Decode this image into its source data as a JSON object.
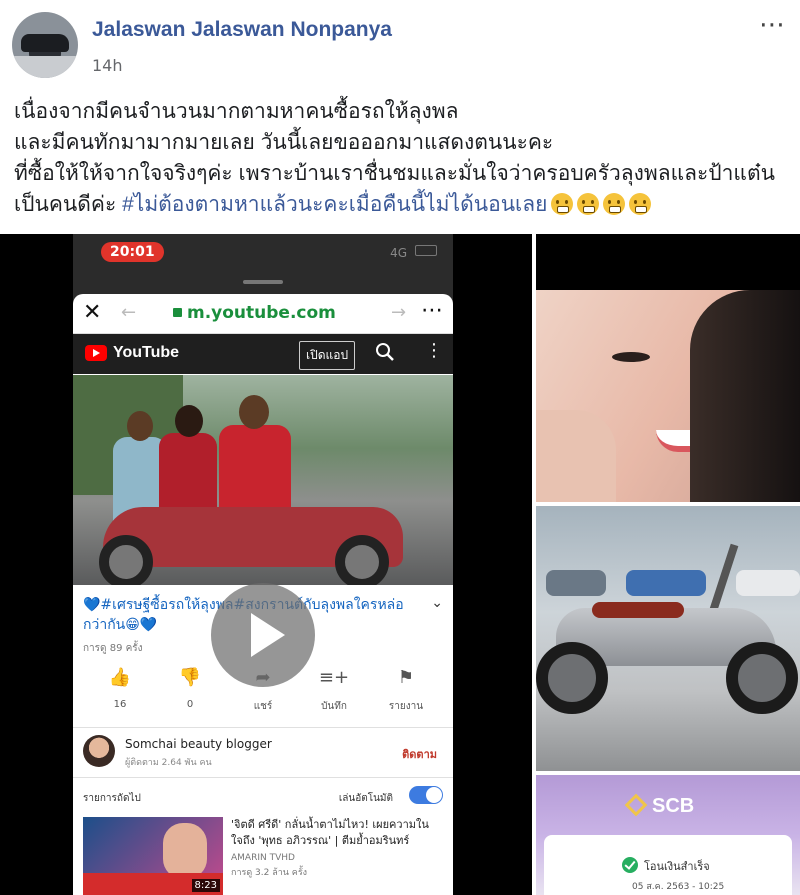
{
  "post": {
    "author": "Jalaswan Jalaswan Nonpanya",
    "time": "14h",
    "more_icon": "⋯",
    "text_lines": [
      "เนื่องจากมีคนจำนวนมากตามหาคนซื้อรถให้ลุงพล",
      "และมีคนทักมามากมายเลย วันนี้เลยขอออกมาแสดงตนนะคะ",
      "ที่ซื้อให้ให้จากใจจริงๆค่ะ เพราะบ้านเราชื่นชมและมั่นใจว่าครอบครัวลุงพลและป้าแต๋น",
      "เป็นคนดีค่ะ "
    ],
    "hashtag": "#ไม่ต้องตามหาแล้วนะคะเมื่อคืนนี้ไม่ได้นอนเลย",
    "emoji_count": 4
  },
  "phone": {
    "status_time": "20:01",
    "status_network": "4G",
    "browser": {
      "close": "✕",
      "back": "←",
      "forward": "→",
      "url": "m.youtube.com",
      "menu": "⋯"
    },
    "youtube": {
      "brand": "YouTube",
      "open_app": "เปิดแอป",
      "menu": "⋮"
    },
    "video": {
      "title": "💙#เศรษฐีซื้อรถให้ลุงพล#สงกรานต์กับลุงพลใครหล่อกว่ากัน😁💙",
      "views": "การดู 89 ครั้ง",
      "actions": [
        {
          "icon": "👍",
          "label": "16"
        },
        {
          "icon": "👎",
          "label": "0"
        },
        {
          "icon": "➦",
          "label": "แชร์"
        },
        {
          "icon": "≡+",
          "label": "บันทึก"
        },
        {
          "icon": "⚑",
          "label": "รายงาน"
        }
      ],
      "channel_name": "Somchai beauty blogger",
      "channel_subs": "ผู้ติดตาม 2.64 พัน คน",
      "subscribe": "ติดตาม",
      "up_next": "รายการถัดไป",
      "autoplay": "เล่นอัตโนมัติ",
      "next": {
        "title": "'จิตดี ศรีดี' กลั่นน้ำตาไม่ไหว! เผยความในใจถึง 'พุทธ อภิวรรณ' | ตีมย้ำอมรินทร์",
        "channel": "AMARIN TVHD",
        "views": "การดู 3.2 ล้าน ครั้ง",
        "duration": "8:23"
      }
    }
  },
  "side_photos": {
    "scb": {
      "logo": "SCB",
      "status": "โอนเงินสำเร็จ",
      "date": "05 ส.ค. 2563 - 10:25"
    }
  },
  "colors": {
    "author": "#3b5998",
    "hashtag": "#3b5998",
    "url_green": "#1a8f3c",
    "youtube_red": "#ff0000",
    "subscribe_red": "#c0392b"
  }
}
